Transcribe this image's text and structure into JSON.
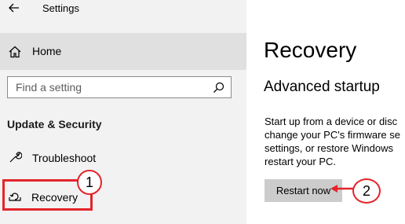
{
  "window": {
    "title": "Settings"
  },
  "sidebar": {
    "home_label": "Home",
    "search": {
      "placeholder": "Find a setting"
    },
    "section_title": "Update & Security",
    "items": [
      {
        "label": "Troubleshoot"
      },
      {
        "label": "Recovery",
        "selected": true
      }
    ]
  },
  "main": {
    "title": "Recovery",
    "section": {
      "title": "Advanced startup",
      "description_lines": [
        "Start up from a device or disc",
        "change your PC's firmware se",
        "settings, or restore Windows",
        "restart your PC."
      ],
      "button_label": "Restart now"
    }
  },
  "annotations": {
    "step1": "1",
    "step2": "2",
    "color": "#e2252b"
  },
  "colors": {
    "sidebar_bg": "#f2f2f2",
    "home_highlight": "#e0e0e0",
    "button_bg": "#cccccc"
  },
  "icons": [
    "back-arrow-icon",
    "home-icon",
    "search-icon",
    "wrench-icon",
    "recovery-icon"
  ]
}
